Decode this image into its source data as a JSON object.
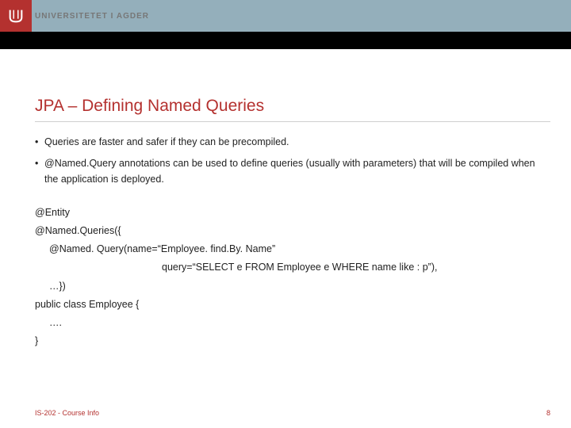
{
  "header": {
    "university": "UNIVERSITETET I AGDER"
  },
  "title": "JPA – Defining Named Queries",
  "bullets": [
    "Queries are faster and safer if they can be precompiled.",
    "@Named.Query annotations can be used to define queries (usually with parameters) that will be compiled when the application is deployed."
  ],
  "code": {
    "l1": "@Entity",
    "l2": "@Named.Queries({",
    "l3": "@Named. Query(name=“Employee. find.By. Name”",
    "l4": "query=“SELECT e FROM Employee e WHERE name like : p”),",
    "l5": "…})",
    "l6": "public class Employee {",
    "l7": "….",
    "l8": "}"
  },
  "footer": {
    "left": "IS-202 - Course Info",
    "right": "8"
  }
}
